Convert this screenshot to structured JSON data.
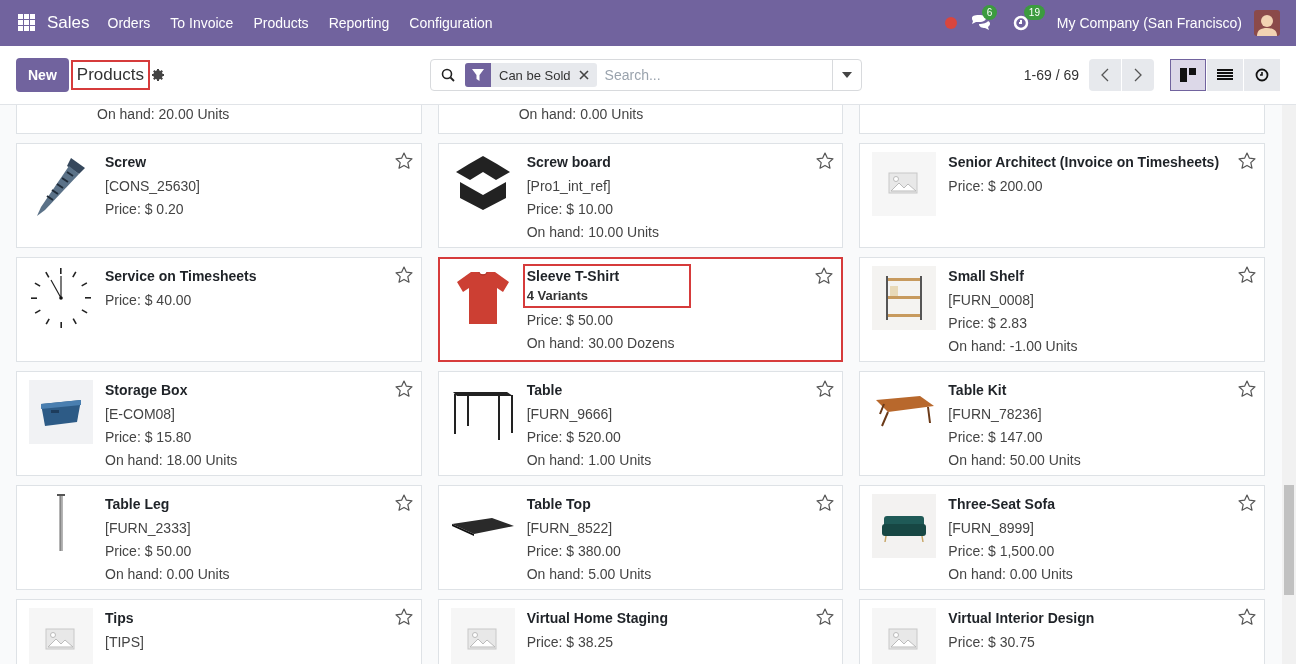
{
  "navbar": {
    "app": "Sales",
    "menu": [
      "Orders",
      "To Invoice",
      "Products",
      "Reporting",
      "Configuration"
    ],
    "messages_count": "6",
    "activities_count": "19",
    "company": "My Company (San Francisco)"
  },
  "control_panel": {
    "new_button": "New",
    "breadcrumb": {
      "label": "Products",
      "highlighted": true
    },
    "search": {
      "facet": "Can be Sold",
      "placeholder": "Search..."
    },
    "pager": "1-69 / 69",
    "views": [
      {
        "kind": "kanban",
        "selected": true
      },
      {
        "kind": "list",
        "selected": false
      },
      {
        "kind": "activity",
        "selected": false
      }
    ]
  },
  "partial_row": [
    {
      "kind": "stock",
      "on_hand": "On hand: 20.00 Units"
    },
    {
      "kind": "stock",
      "on_hand": "On hand: 0.00 Units"
    },
    {
      "kind": "empty"
    }
  ],
  "products": [
    {
      "name": "Screw",
      "reference": "[CONS_25630]",
      "price": "Price: $ 0.20",
      "kind": "screw",
      "favorite": false,
      "highlighted": false
    },
    {
      "name": "Screw board",
      "reference": "[Pro1_int_ref]",
      "price": "Price: $ 10.00",
      "on_hand": "On hand: 10.00 Units",
      "kind": "box",
      "favorite": false,
      "highlighted": false
    },
    {
      "name": "Senior Architect (Invoice on Timesheets)",
      "price": "Price: $ 200.00",
      "kind": "placeholder",
      "favorite": false,
      "highlighted": false
    },
    {
      "name": "Service on Timesheets",
      "price": "Price: $ 40.00",
      "kind": "clock",
      "favorite": false,
      "highlighted": false
    },
    {
      "name": "Sleeve T-Shirt",
      "variants": "4 Variants",
      "price": "Price: $ 50.00",
      "on_hand": "On hand: 30.00 Dozens",
      "kind": "tshirt",
      "favorite": false,
      "highlighted": true
    },
    {
      "name": "Small Shelf",
      "reference": "[FURN_0008]",
      "price": "Price: $ 2.83",
      "on_hand": "On hand: -1.00 Units",
      "kind": "shelf",
      "favorite": false,
      "highlighted": false
    },
    {
      "name": "Storage Box",
      "reference": "[E-COM08]",
      "price": "Price: $ 15.80",
      "on_hand": "On hand: 18.00 Units",
      "kind": "storage",
      "favorite": false,
      "highlighted": false
    },
    {
      "name": "Table",
      "reference": "[FURN_9666]",
      "price": "Price: $ 520.00",
      "on_hand": "On hand: 1.00 Units",
      "kind": "table",
      "favorite": false,
      "highlighted": false
    },
    {
      "name": "Table Kit",
      "reference": "[FURN_78236]",
      "price": "Price: $ 147.00",
      "on_hand": "On hand: 50.00 Units",
      "kind": "tablekit",
      "favorite": false,
      "highlighted": false
    },
    {
      "name": "Table Leg",
      "reference": "[FURN_2333]",
      "price": "Price: $ 50.00",
      "on_hand": "On hand: 0.00 Units",
      "kind": "leg",
      "favorite": false,
      "highlighted": false
    },
    {
      "name": "Table Top",
      "reference": "[FURN_8522]",
      "price": "Price: $ 380.00",
      "on_hand": "On hand: 5.00 Units",
      "kind": "tabletop",
      "favorite": false,
      "highlighted": false
    },
    {
      "name": "Three-Seat Sofa",
      "reference": "[FURN_8999]",
      "price": "Price: $ 1,500.00",
      "on_hand": "On hand: 0.00 Units",
      "kind": "sofa",
      "favorite": false,
      "highlighted": false
    },
    {
      "name": "Tips",
      "reference": "[TIPS]",
      "kind": "placeholder",
      "favorite": false,
      "highlighted": false
    },
    {
      "name": "Virtual Home Staging",
      "price": "Price: $ 38.25",
      "kind": "placeholder",
      "favorite": false,
      "highlighted": false
    },
    {
      "name": "Virtual Interior Design",
      "price": "Price: $ 30.75",
      "kind": "placeholder",
      "favorite": false,
      "highlighted": false
    }
  ]
}
